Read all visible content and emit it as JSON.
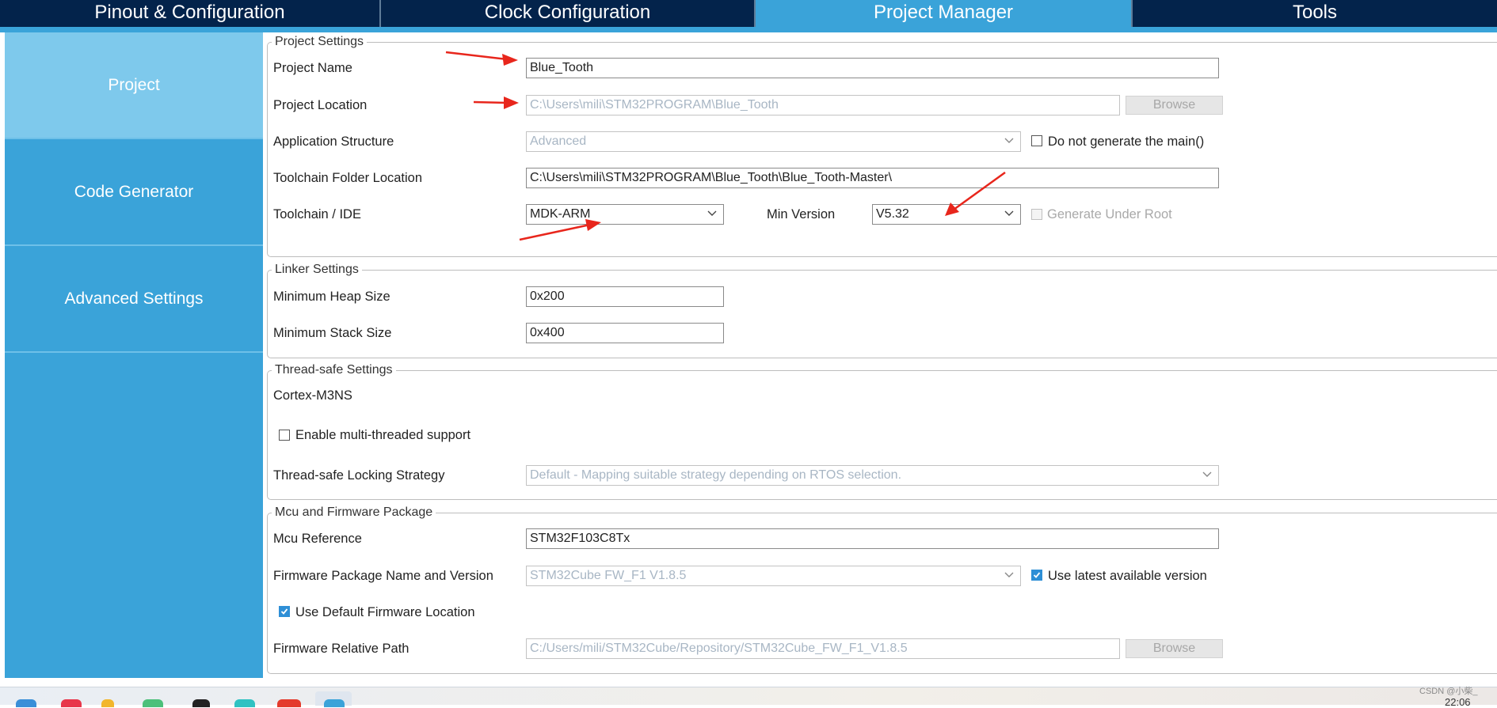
{
  "tabs": [
    {
      "label": "Pinout & Configuration"
    },
    {
      "label": "Clock Configuration"
    },
    {
      "label": "Project Manager"
    },
    {
      "label": "Tools"
    }
  ],
  "sidebar": {
    "items": [
      {
        "label": "Project"
      },
      {
        "label": "Code Generator"
      },
      {
        "label": "Advanced Settings"
      }
    ]
  },
  "project_settings": {
    "legend": "Project Settings",
    "project_name_label": "Project Name",
    "project_name_value": "Blue_Tooth",
    "project_location_label": "Project Location",
    "project_location_value": "C:\\Users\\mili\\STM32PROGRAM\\Blue_Tooth",
    "browse_label": "Browse",
    "app_structure_label": "Application Structure",
    "app_structure_value": "Advanced",
    "no_main_label": "Do not generate the main()",
    "toolchain_folder_label": "Toolchain Folder Location",
    "toolchain_folder_value": "C:\\Users\\mili\\STM32PROGRAM\\Blue_Tooth\\Blue_Tooth-Master\\",
    "toolchain_ide_label": "Toolchain / IDE",
    "toolchain_ide_value": "MDK-ARM",
    "min_version_label": "Min Version",
    "min_version_value": "V5.32",
    "generate_under_root_label": "Generate Under Root"
  },
  "linker_settings": {
    "legend": "Linker Settings",
    "heap_label": "Minimum Heap Size",
    "heap_value": "0x200",
    "stack_label": "Minimum Stack Size",
    "stack_value": "0x400"
  },
  "thread_safe": {
    "legend": "Thread-safe Settings",
    "core_label": "Cortex-M3NS",
    "multithread_label": "Enable multi-threaded support",
    "strategy_label": "Thread-safe Locking Strategy",
    "strategy_value": "Default  -  Mapping suitable strategy depending on RTOS selection."
  },
  "mcu_firmware": {
    "legend": "Mcu and Firmware Package",
    "mcu_ref_label": "Mcu Reference",
    "mcu_ref_value": "STM32F103C8Tx",
    "fw_name_label": "Firmware Package Name and Version",
    "fw_name_value": "STM32Cube FW_F1 V1.8.5",
    "latest_version_label": "Use latest available version",
    "default_location_label": "Use Default Firmware Location",
    "fw_path_label": "Firmware Relative Path",
    "fw_path_value": "C:/Users/mili/STM32Cube/Repository/STM32Cube_FW_F1_V1.8.5",
    "browse_label": "Browse"
  },
  "checkbox_states": {
    "no_main": false,
    "generate_under_root": false,
    "multithread": false,
    "latest_version": true,
    "default_location": true
  },
  "colors": {
    "nav_dark": "#03234b",
    "accent": "#3aa3d9",
    "sidebar_active": "#7ec9ec",
    "annotation_arrow": "#e8261c"
  },
  "taskbar": {
    "watermark": "CSDN @小柴_",
    "time": "22:06"
  }
}
